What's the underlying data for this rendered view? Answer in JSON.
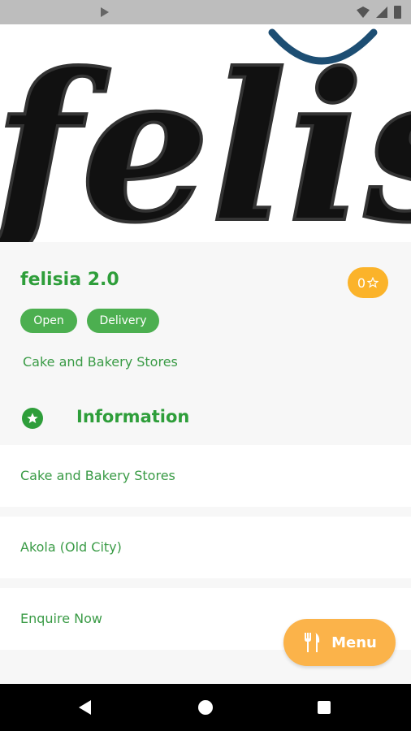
{
  "hero": {
    "logo_text": "felisia"
  },
  "store": {
    "name": "felisia 2.0",
    "rating": "0",
    "badges": {
      "open": "Open",
      "delivery": "Delivery"
    },
    "category": "Cake and Bakery Stores"
  },
  "information": {
    "title": "Information",
    "rows": [
      "Cake and Bakery Stores",
      "Akola (Old City)",
      "Enquire Now"
    ]
  },
  "fab": {
    "label": "Menu",
    "icon": "fork-knife-icon"
  },
  "colors": {
    "green": "#2e9e3a",
    "orange": "#fbb32a",
    "badge_green": "#4caf50"
  }
}
